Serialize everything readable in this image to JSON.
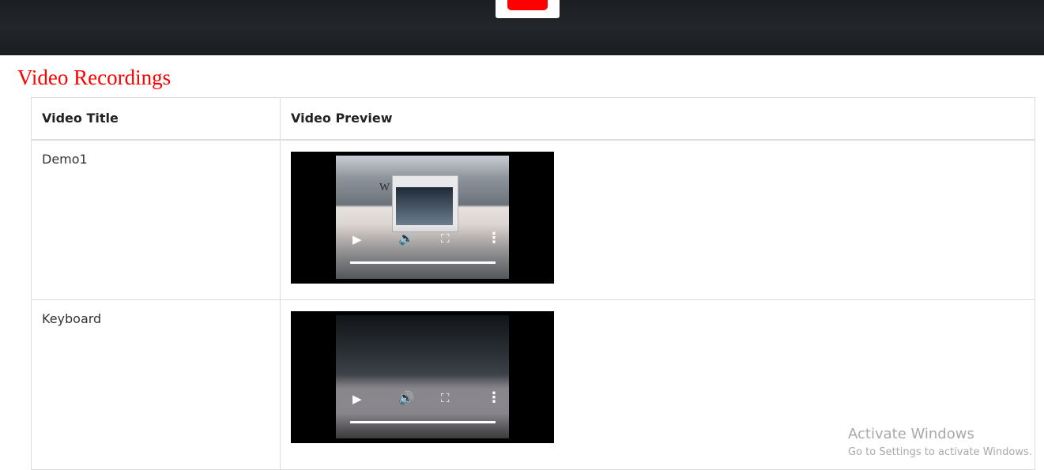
{
  "header": {
    "logo_icon": "youtube-logo-icon",
    "brand_color": "#ff0000"
  },
  "page": {
    "section_title": "Video Recordings"
  },
  "table": {
    "columns": [
      "Video Title",
      "Video Preview"
    ],
    "rows": [
      {
        "title": "Demo1",
        "preview": {
          "frame_text": "W         ORDER",
          "controls": {
            "play_icon": "play-icon",
            "volume_icon": "volume-icon",
            "fullscreen_icon": "fullscreen-icon",
            "more_icon": "more-options-icon"
          }
        }
      },
      {
        "title": "Keyboard",
        "preview": {
          "controls": {
            "play_icon": "play-icon",
            "volume_icon": "volume-icon",
            "fullscreen_icon": "fullscreen-icon",
            "more_icon": "more-options-icon"
          }
        }
      }
    ]
  },
  "watermark": {
    "title": "Activate Windows",
    "subtitle": "Go to Settings to activate Windows."
  },
  "colors": {
    "section_title": "#ff0000",
    "banner_bg": "#1c1f22",
    "table_border": "#dddddd"
  }
}
